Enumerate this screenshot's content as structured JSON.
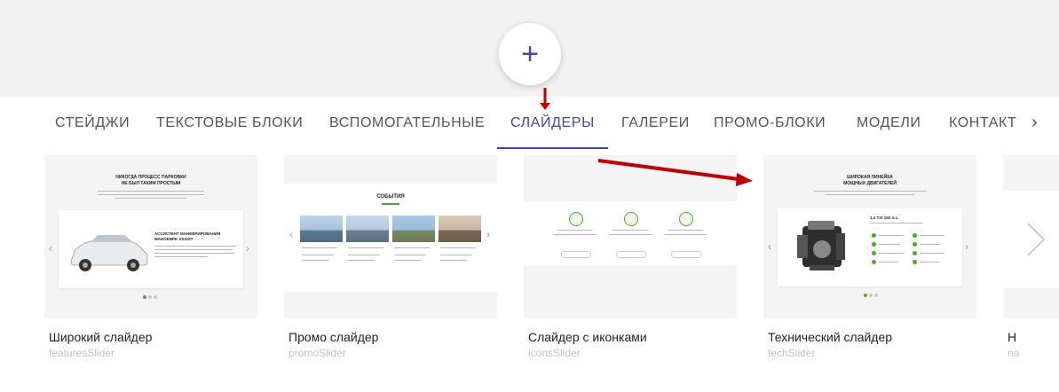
{
  "add_button": {
    "icon": "plus-icon",
    "glyph": "+"
  },
  "tabs": [
    {
      "label": "СТЕЙДЖИ"
    },
    {
      "label": "ТЕКСТОВЫЕ БЛОКИ"
    },
    {
      "label": "ВСПОМОГАТЕЛЬНЫЕ"
    },
    {
      "label": "СЛАЙДЕРЫ"
    },
    {
      "label": "ГАЛЕРЕИ"
    },
    {
      "label": "ПРОМО-БЛОКИ"
    },
    {
      "label": "МОДЕЛИ"
    },
    {
      "label": "КОНТАКТ"
    }
  ],
  "active_tab": "СЛАЙДЕРЫ",
  "tabs_next_glyph": "›",
  "cards": [
    {
      "title": "Широкий слайдер",
      "subtitle": "featuresSlider"
    },
    {
      "title": "Промо слайдер",
      "subtitle": "promoSlider"
    },
    {
      "title": "Слайдер с иконками",
      "subtitle": "iconsSlider"
    },
    {
      "title": "Технический слайдер",
      "subtitle": "techSlider"
    },
    {
      "title": "Н",
      "subtitle": "na"
    }
  ],
  "thumbnail_text": {
    "features_heading_1": "НИКОГДА ПРОЦЕСС ПАРКОВКИ",
    "features_heading_2": "НЕ БЫЛ ТАКИМ ПРОСТЫМ",
    "features_card_heading": "АССИСТЕНТ МАНЕВРИРОВАНИЯ МАНОЕВРЕ ASSIST",
    "promo_heading": "СОБЫТИЯ",
    "tech_heading_1": "ШИРОКАЯ ЛИНЕЙКА",
    "tech_heading_2": "МОЩНЫХ ДВИГАТЕЛЕЙ",
    "tech_engine_label": "1.4 TSI 150 л.с."
  },
  "colors": {
    "accent": "#3b4ba5",
    "green": "#4ba82e",
    "annotation_red": "#c00000"
  }
}
